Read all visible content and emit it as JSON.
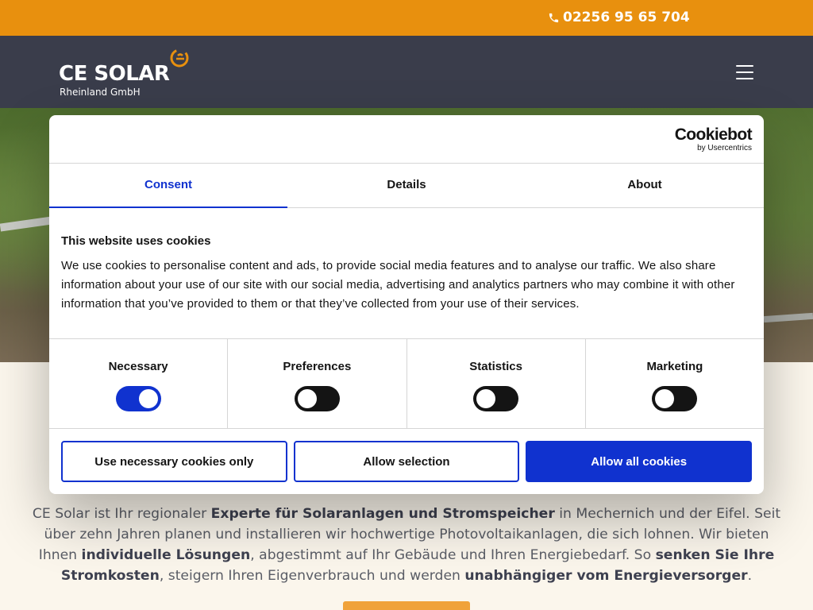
{
  "topbar": {
    "phone": "02256 95 65 704",
    "icon": "phone-icon"
  },
  "header": {
    "logo_main": "CE SOLAR",
    "logo_sub": "Rheinland GmbH",
    "menu_icon": "hamburger-menu-icon"
  },
  "cookie": {
    "brand_name": "Cookiebot",
    "brand_sub": "by Usercentrics",
    "tabs": [
      {
        "label": "Consent",
        "active": true
      },
      {
        "label": "Details",
        "active": false
      },
      {
        "label": "About",
        "active": false
      }
    ],
    "title": "This website uses cookies",
    "text": "We use cookies to personalise content and ads, to provide social media features and to analyse our traffic. We also share information about your use of our site with our social media, advertising and analytics partners who may combine it with other information that you’ve provided to them or that they’ve collected from your use of their services.",
    "switches": [
      {
        "label": "Necessary",
        "on": true
      },
      {
        "label": "Preferences",
        "on": false
      },
      {
        "label": "Statistics",
        "on": false
      },
      {
        "label": "Marketing",
        "on": false
      }
    ],
    "buttons": {
      "necessary_only": "Use necessary cookies only",
      "allow_selection": "Allow selection",
      "allow_all": "Allow all cookies"
    }
  },
  "intro": {
    "p1": "CE Solar ist Ihr regionaler ",
    "b1": "Experte für Solaranlagen und Stromspeicher",
    "p2": " in Mechernich und der Eifel. Seit über zehn Jahren planen und installieren wir hochwertige Photovoltaikanlagen, die sich lohnen. Wir bieten Ihnen ",
    "b2": "individuelle Lösungen",
    "p3": ", abgestimmt auf Ihr Gebäude und Ihren Energiebedarf. So ",
    "b3": "senken Sie Ihre Stromkosten",
    "p4": ", steigern Ihren Eigenverbrauch und werden ",
    "b4": "unabhängiger vom Energieversorger",
    "p5": "."
  },
  "colors": {
    "accent": "#e8900e",
    "header": "#3a3d4b",
    "cookie_blue": "#1032cf"
  }
}
